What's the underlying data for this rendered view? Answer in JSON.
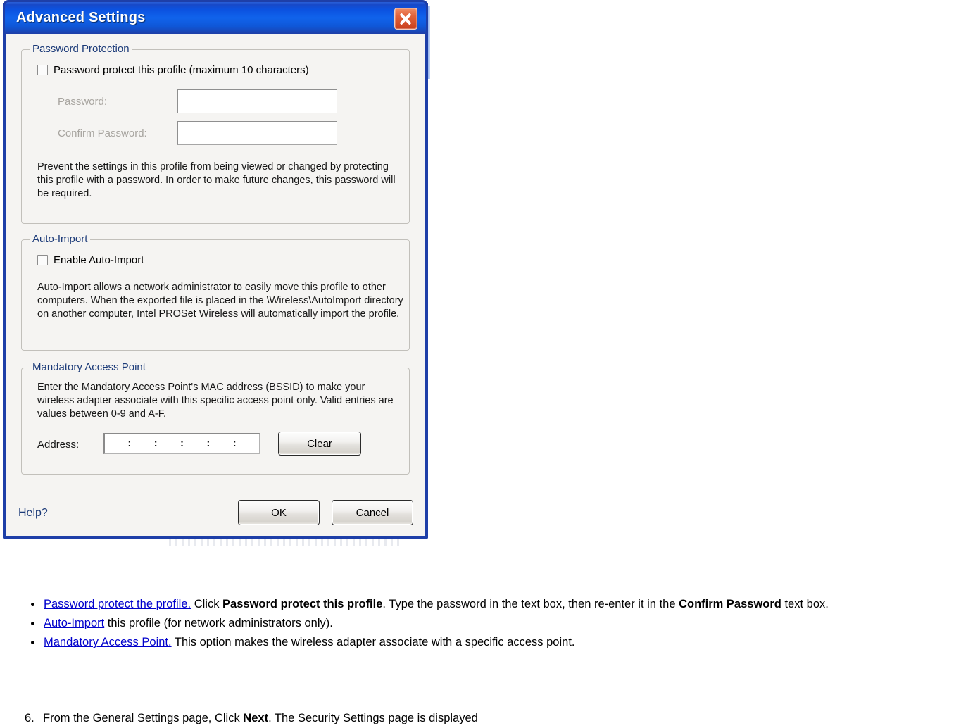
{
  "dialog": {
    "title": "Advanced Settings",
    "close_icon": "close-icon",
    "password_protection": {
      "group_title": "Password Protection",
      "checkbox_label": "Password protect this profile (maximum 10 characters)",
      "password_label": "Password:",
      "password_value": "",
      "confirm_label": "Confirm Password:",
      "confirm_value": "",
      "description": "Prevent the settings in this profile from being viewed or changed by protecting this profile with a password. In order to make future changes, this password will be required."
    },
    "auto_import": {
      "group_title": "Auto-Import",
      "checkbox_label": "Enable Auto-Import",
      "description": "Auto-Import allows a network administrator to easily move this profile to other computers. When the exported file is placed in the \\Wireless\\AutoImport directory on another computer, Intel PROSet Wireless will automatically import the profile."
    },
    "mandatory_ap": {
      "group_title": "Mandatory Access Point",
      "description": "Enter the Mandatory Access Point's MAC address (BSSID) to make your wireless adapter associate with this specific access point only. Valid entries are values between 0-9 and A-F.",
      "address_label": "Address:",
      "address_value": "",
      "colon_separator": ":",
      "clear_button_accel": "C",
      "clear_button_rest": "lear"
    },
    "footer": {
      "help_label": "Help?",
      "ok_label": "OK",
      "cancel_label": "Cancel"
    }
  },
  "document": {
    "bullets": [
      {
        "link": "Password protect the profile.",
        "text_1": " Click ",
        "bold_1": "Password protect this profile",
        "text_2": ". Type the password in the text box, then re-enter it in the ",
        "bold_2": "Confirm Password",
        "text_3": " text box."
      },
      {
        "link": "Auto-Import",
        "text_1": " this profile (for network administrators only).",
        "bold_1": "",
        "text_2": "",
        "bold_2": "",
        "text_3": ""
      },
      {
        "link": "Mandatory Access Point.",
        "text_1": " This option makes the wireless adapter associate with a specific access point.",
        "bold_1": "",
        "text_2": "",
        "bold_2": "",
        "text_3": ""
      }
    ],
    "step": {
      "number": "6.",
      "text_1": "From the General Settings page, Click ",
      "bold": "Next",
      "text_2": ". The Security Settings page is displayed"
    }
  },
  "colors": {
    "title_bar_blue": "#0c52e0",
    "dialog_border": "#1e3fa8",
    "group_title": "#1b3a78",
    "link_blue": "#0000cc",
    "disabled_label": "#a8a5a0",
    "close_red": "#c9401c"
  }
}
